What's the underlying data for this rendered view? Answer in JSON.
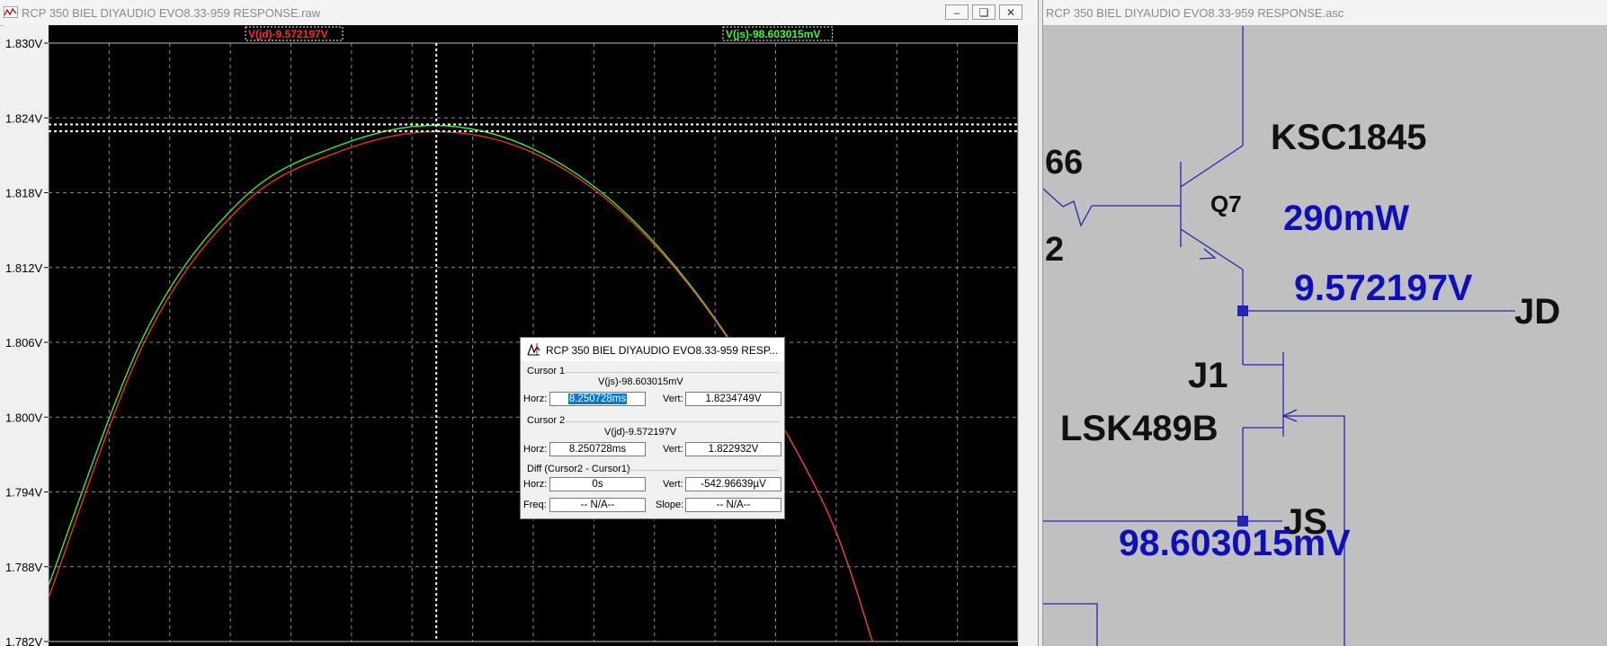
{
  "plot_window": {
    "title": "RCP 350 BIEL DIYAUDIO EVO8.33-959 RESPONSE.raw",
    "minimize_icon": "minimize-icon",
    "restore_icon": "restore-icon",
    "close_icon": "close-icon",
    "trace_labels": [
      {
        "text": "V(jd)-9.572197V",
        "color": "#ff2a2a"
      },
      {
        "text": "V(js)-98.603015mV",
        "color": "#33ff33"
      }
    ]
  },
  "chart_data": {
    "type": "line",
    "title": "",
    "xlabel": "",
    "ylabel": "",
    "ylim": [
      1.782,
      1.83
    ],
    "y_ticks": [
      "1.830V",
      "1.824V",
      "1.818V",
      "1.812V",
      "1.806V",
      "1.800V",
      "1.794V",
      "1.788V",
      "1.782V"
    ],
    "grid": true,
    "background": "#000000",
    "series": [
      {
        "name": "V(js)-98.603015mV",
        "color": "#33ff33",
        "x": [
          0,
          0.1,
          0.2,
          0.3,
          0.4,
          0.5,
          0.6,
          0.7,
          0.8,
          0.85
        ],
        "y": [
          1.7865,
          1.8068,
          1.8175,
          1.8218,
          1.8234,
          1.8215,
          1.816,
          1.8065,
          1.793,
          1.782
        ]
      },
      {
        "name": "V(jd)-9.572197V",
        "color": "#ff3030",
        "x": [
          0,
          0.1,
          0.2,
          0.3,
          0.4,
          0.5,
          0.6,
          0.7,
          0.8,
          0.85
        ],
        "y": [
          1.7855,
          1.8062,
          1.817,
          1.8213,
          1.8229,
          1.8212,
          1.8158,
          1.8064,
          1.793,
          1.782
        ]
      }
    ],
    "cursors": {
      "vertical_x": 0.4,
      "horizontal_y": [
        1.8234749,
        1.822932
      ]
    }
  },
  "cursor_dialog": {
    "title": "RCP 350 BIEL DIYAUDIO EVO8.33-959 RESP...",
    "close_icon": "close-icon",
    "cursor1": {
      "label": "Cursor 1",
      "trace": "V(js)-98.603015mV",
      "horz_label": "Horz:",
      "horz_value": "8.250728ms",
      "vert_label": "Vert:",
      "vert_value": "1.8234749V"
    },
    "cursor2": {
      "label": "Cursor 2",
      "trace": "V(jd)-9.572197V",
      "horz_label": "Horz:",
      "horz_value": "8.250728ms",
      "vert_label": "Vert:",
      "vert_value": "1.822932V"
    },
    "diff": {
      "label": "Diff (Cursor2 - Cursor1)",
      "horz_label": "Horz:",
      "horz_value": "0s",
      "vert_label": "Vert:",
      "vert_value": "-542.96639µV",
      "freq_label": "Freq:",
      "freq_value": "-- N/A--",
      "slope_label": "Slope:",
      "slope_value": "-- N/A--"
    }
  },
  "schematic_window": {
    "title": "RCP 350 BIEL DIYAUDIO EVO8.33-959 RESPONSE.asc",
    "labels": {
      "part_fragment_top": "66",
      "part_fragment_bottom": "2",
      "q7_model": "KSC1845",
      "q7_ref": "Q7",
      "q7_power": "290mW",
      "jd_voltage": "9.572197V",
      "jd_net": "JD",
      "j1_ref": "J1",
      "j1_model": "LSK489B",
      "js_net": "JS",
      "js_voltage": "98.603015mV"
    },
    "wire_color": "#2424b8",
    "label_color": "#0d0fbd"
  }
}
